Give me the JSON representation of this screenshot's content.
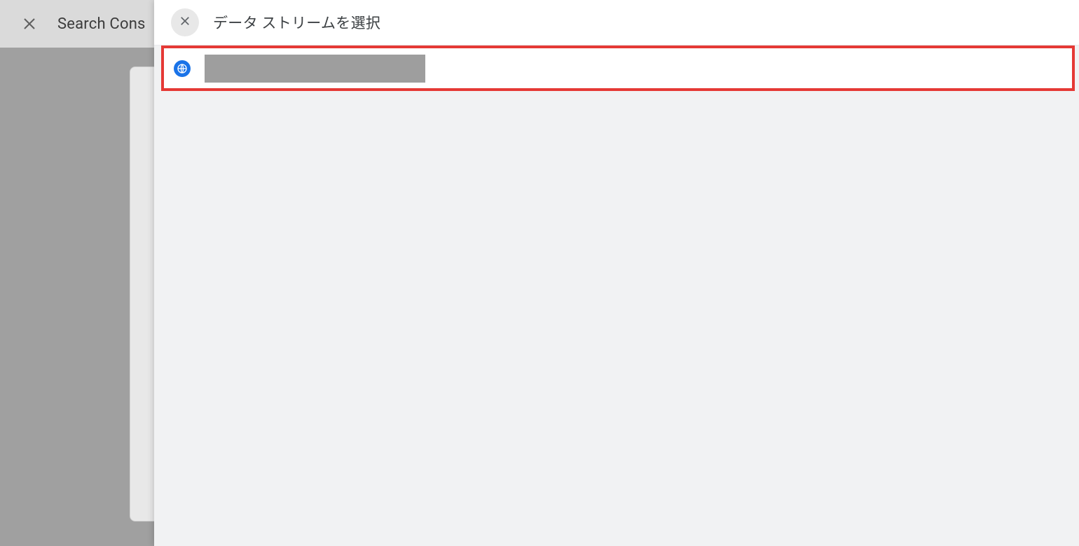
{
  "background": {
    "title": "Search Cons"
  },
  "panel": {
    "title": "データ ストリームを選択",
    "stream": {
      "name": ""
    }
  },
  "colors": {
    "highlight_border": "#e53935",
    "accent": "#1a73e8",
    "redacted": "#9e9e9e"
  }
}
